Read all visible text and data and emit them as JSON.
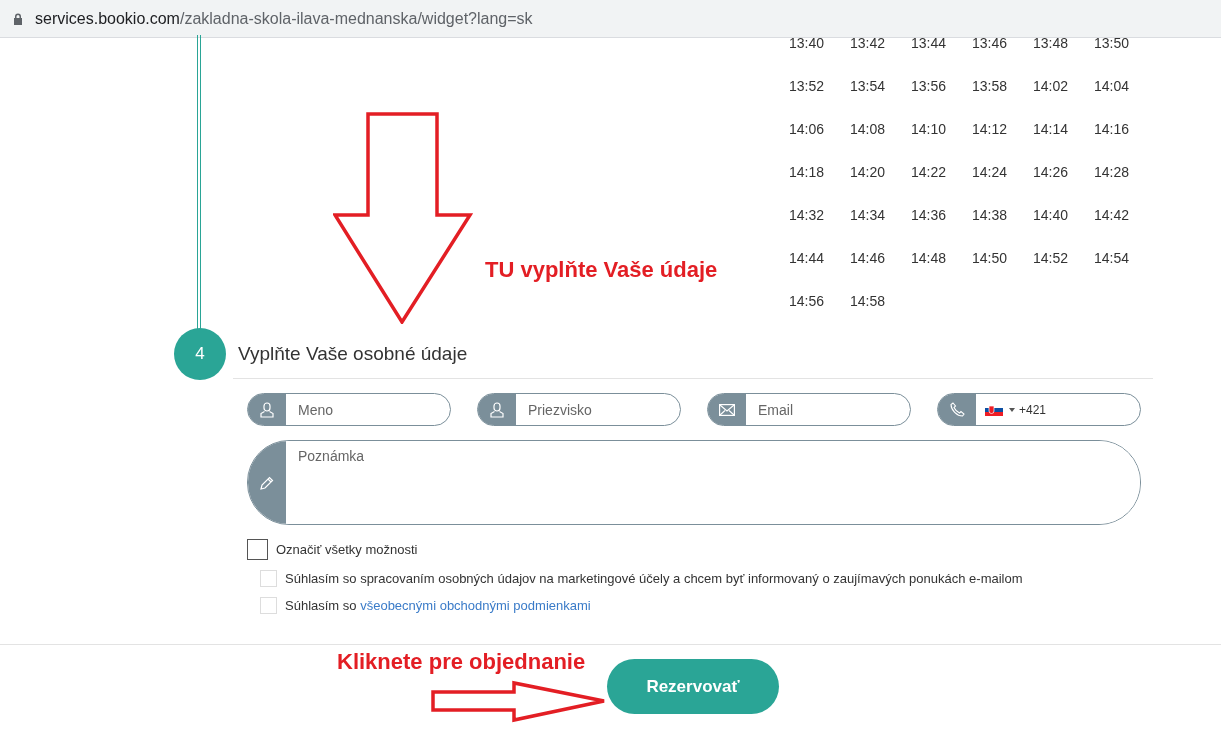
{
  "browser": {
    "url_host": "services.bookio.com",
    "url_path": "/zakladna-skola-ilava-mednanska/widget?lang=sk"
  },
  "time_slots": [
    "13:40",
    "13:42",
    "13:44",
    "13:46",
    "13:48",
    "13:50",
    "13:52",
    "13:54",
    "13:56",
    "13:58",
    "14:02",
    "14:04",
    "14:06",
    "14:08",
    "14:10",
    "14:12",
    "14:14",
    "14:16",
    "14:18",
    "14:20",
    "14:22",
    "14:24",
    "14:26",
    "14:28",
    "14:32",
    "14:34",
    "14:36",
    "14:38",
    "14:40",
    "14:42",
    "14:44",
    "14:46",
    "14:48",
    "14:50",
    "14:52",
    "14:54",
    "14:56",
    "14:58"
  ],
  "step": {
    "number": "4",
    "title": "Vyplňte Vaše osobné údaje"
  },
  "fields": [
    {
      "kind": "person",
      "placeholder": "Meno"
    },
    {
      "kind": "person",
      "placeholder": "Priezvisko"
    },
    {
      "kind": "email",
      "placeholder": "Email"
    },
    {
      "kind": "phone",
      "value": "+421"
    }
  ],
  "note": {
    "placeholder": "Poznámka"
  },
  "select_all": {
    "label": "Označiť všetky možnosti",
    "checked": false
  },
  "consents": [
    {
      "text": "Súhlasím so spracovaním osobných údajov na marketingové účely a chcem byť informovaný o zaujímavých ponukách e-mailom",
      "checked": false
    },
    {
      "text": "Súhlasím so",
      "link": "všeobecnými obchodnými podmienkami",
      "checked": false
    }
  ],
  "submit": "Rezervovať",
  "annotations": [
    {
      "kind": "down-arrow",
      "text": "TU vyplňte Vaše údaje"
    },
    {
      "kind": "right-arrow",
      "text": "Kliknete pre objednanie"
    }
  ]
}
